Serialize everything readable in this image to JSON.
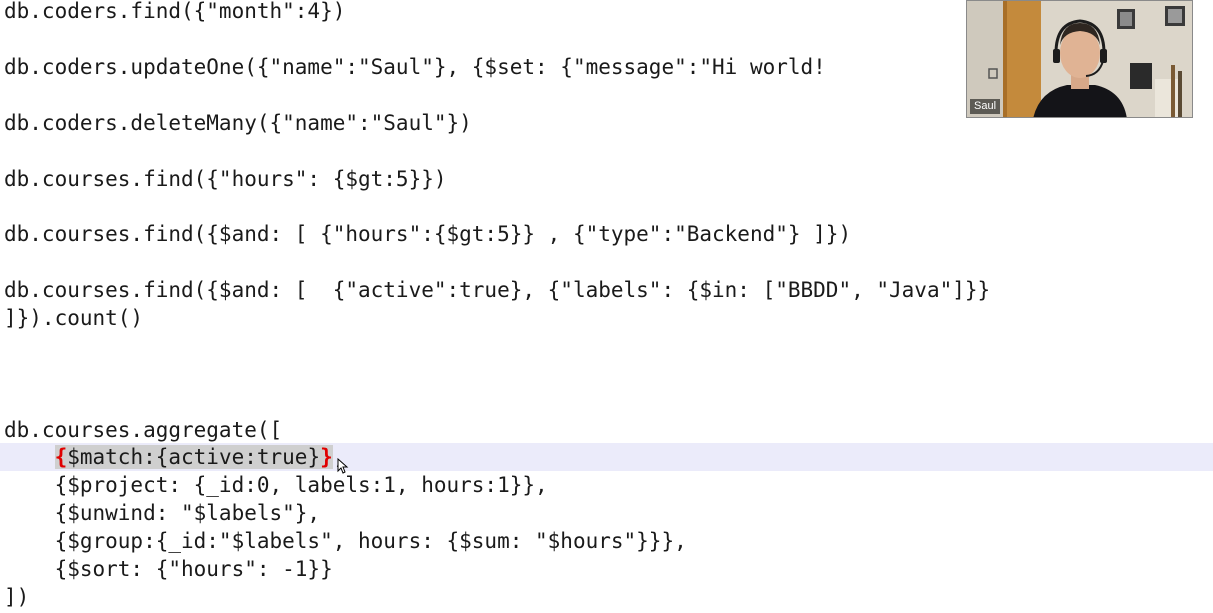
{
  "code_lines": [
    "db.coders.find({\"month\":4})",
    "db.coders.updateOne({\"name\":\"Saul\"}, {$set: {\"message\":\"Hi world!",
    "db.coders.deleteMany({\"name\":\"Saul\"})",
    "db.courses.find({\"hours\": {$gt:5}})",
    "db.courses.find({$and: [ {\"hours\":{$gt:5}} , {\"type\":\"Backend\"} ]})",
    "db.courses.find({$and: [  {\"active\":true}, {\"labels\": {$in: [\"BBDD\", \"Java\"]}}",
    "]}).count()",
    "db.courses.aggregate([",
    "    {$match:{active:true}},",
    "    {$project: {_id:0, labels:1, hours:1}},",
    "    {$unwind: \"$labels\"},",
    "    {$group:{_id:\"$labels\", hours: {$sum: \"$hours\"}}},",
    "    {$sort: {\"hours\": -1}}",
    "])"
  ],
  "highlighted_line": {
    "indent": "    ",
    "open_brace": "{",
    "inner": "$match:{active:true}",
    "close_brace": "}",
    "trailing": ","
  },
  "video": {
    "participant_name": "Saul"
  },
  "colors": {
    "code_text": "#1a1a1a",
    "matched_brace": "#e00000",
    "current_line_bg": "#ebebfa",
    "selection_bg": "#cfcfcf"
  }
}
